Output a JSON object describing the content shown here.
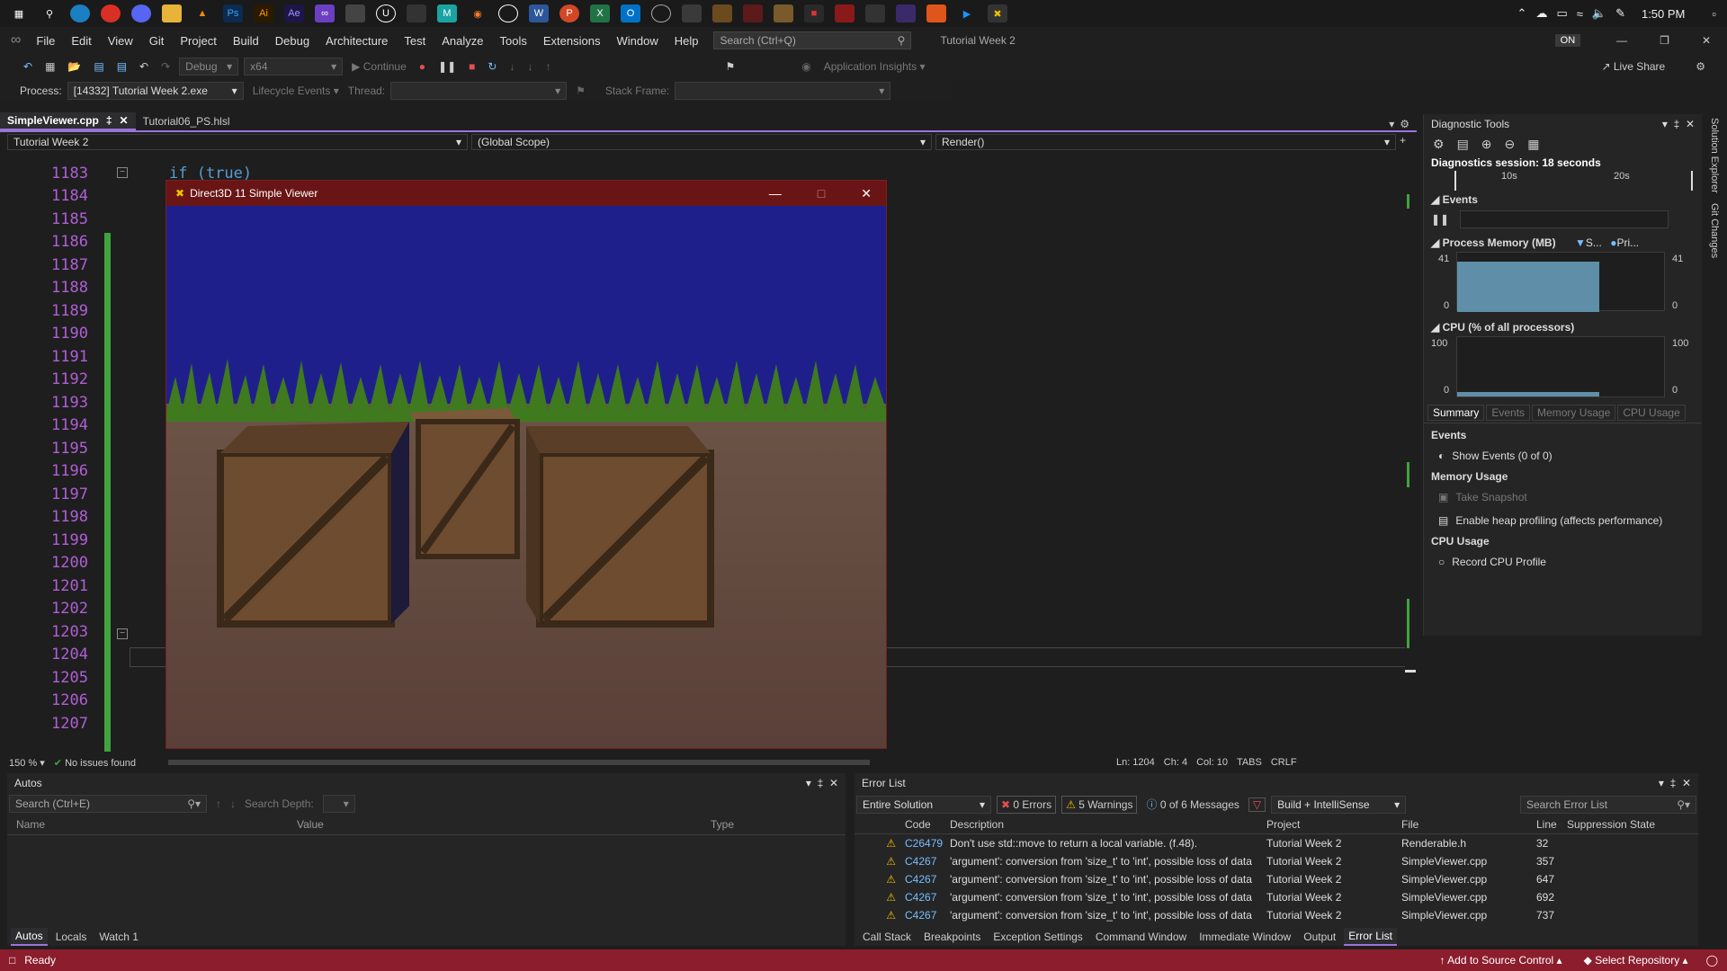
{
  "taskbar": {
    "time": "1:50 PM"
  },
  "menubar": {
    "items": [
      "File",
      "Edit",
      "View",
      "Git",
      "Project",
      "Build",
      "Debug",
      "Architecture",
      "Test",
      "Analyze",
      "Tools",
      "Extensions",
      "Window",
      "Help"
    ],
    "search_placeholder": "Search (Ctrl+Q)",
    "solution_name": "Tutorial Week 2",
    "account_badge": "ON"
  },
  "toolbar": {
    "config": "Debug",
    "platform": "x64",
    "continue_label": "Continue",
    "insights_label": "Application Insights",
    "live_share_label": "Live Share"
  },
  "toolbar2": {
    "process_label": "Process:",
    "process_value": "[14332] Tutorial Week 2.exe",
    "lifecycle_label": "Lifecycle Events",
    "thread_label": "Thread:",
    "stack_frame_label": "Stack Frame:"
  },
  "tabs": [
    {
      "label": "SimpleViewer.cpp"
    },
    {
      "label": "Tutorial06_PS.hlsl"
    }
  ],
  "navbar": {
    "project": "Tutorial Week 2",
    "scope": "(Global Scope)",
    "member": "Render()"
  },
  "editor": {
    "line_numbers": [
      "1183",
      "1184",
      "1185",
      "1186",
      "1187",
      "1188",
      "1189",
      "1190",
      "1191",
      "1192",
      "1193",
      "1194",
      "1195",
      "1196",
      "1197",
      "1198",
      "1199",
      "1200",
      "1201",
      "1202",
      "1203",
      "1204",
      "1205",
      "1206",
      "1207"
    ],
    "code_line_1183": "if (true)"
  },
  "editor_status": {
    "zoom": "150 %",
    "issues": "No issues found",
    "ln": "Ln: 1204",
    "ch": "Ch: 4",
    "col": "Col: 10",
    "tabs": "TABS",
    "eol": "CRLF"
  },
  "dx_window": {
    "title": "Direct3D 11 Simple Viewer"
  },
  "diagnostics": {
    "title": "Diagnostic Tools",
    "session": "Diagnostics session: 18 seconds",
    "tick_10s": "10s",
    "tick_20s": "20s",
    "events_label": "Events",
    "memory_label": "Process Memory (MB)",
    "memory_legend_s": "S...",
    "memory_legend_p": "Pri...",
    "memory_max": "41",
    "memory_min": "0",
    "cpu_label": "CPU (% of all processors)",
    "cpu_max": "100",
    "cpu_min": "0",
    "tabs": [
      "Summary",
      "Events",
      "Memory Usage",
      "CPU Usage"
    ],
    "sec_events": "Events",
    "show_events": "Show Events (0 of 0)",
    "sec_memory": "Memory Usage",
    "take_snapshot": "Take Snapshot",
    "heap_profiling": "Enable heap profiling (affects performance)",
    "sec_cpu": "CPU Usage",
    "record_cpu": "Record CPU Profile"
  },
  "side_tabs": [
    "Solution Explorer",
    "Git Changes"
  ],
  "autos": {
    "title": "Autos",
    "search_placeholder": "Search (Ctrl+E)",
    "search_depth": "Search Depth:",
    "col_name": "Name",
    "col_value": "Value",
    "col_type": "Type",
    "tabs": [
      "Autos",
      "Locals",
      "Watch 1"
    ]
  },
  "error_list": {
    "title": "Error List",
    "scope": "Entire Solution",
    "errors": "0 Errors",
    "warnings": "5 Warnings",
    "messages": "0 of 6 Messages",
    "build_filter": "Build + IntelliSense",
    "search_placeholder": "Search Error List",
    "headers": [
      "Code",
      "Description",
      "Project",
      "File",
      "Line",
      "Suppression State"
    ],
    "rows": [
      {
        "code": "C26479",
        "desc": "Don't use std::move to return a local variable. (f.48).",
        "project": "Tutorial Week 2",
        "file": "Renderable.h",
        "line": "32"
      },
      {
        "code": "C4267",
        "desc": "'argument': conversion from 'size_t' to 'int', possible loss of data",
        "project": "Tutorial Week 2",
        "file": "SimpleViewer.cpp",
        "line": "357"
      },
      {
        "code": "C4267",
        "desc": "'argument': conversion from 'size_t' to 'int', possible loss of data",
        "project": "Tutorial Week 2",
        "file": "SimpleViewer.cpp",
        "line": "647"
      },
      {
        "code": "C4267",
        "desc": "'argument': conversion from 'size_t' to 'int', possible loss of data",
        "project": "Tutorial Week 2",
        "file": "SimpleViewer.cpp",
        "line": "692"
      },
      {
        "code": "C4267",
        "desc": "'argument': conversion from 'size_t' to 'int', possible loss of data",
        "project": "Tutorial Week 2",
        "file": "SimpleViewer.cpp",
        "line": "737"
      }
    ],
    "tabs": [
      "Call Stack",
      "Breakpoints",
      "Exception Settings",
      "Command Window",
      "Immediate Window",
      "Output",
      "Error List"
    ]
  },
  "statusbar": {
    "ready": "Ready",
    "source_control": "Add to Source Control",
    "repository": "Select Repository"
  }
}
